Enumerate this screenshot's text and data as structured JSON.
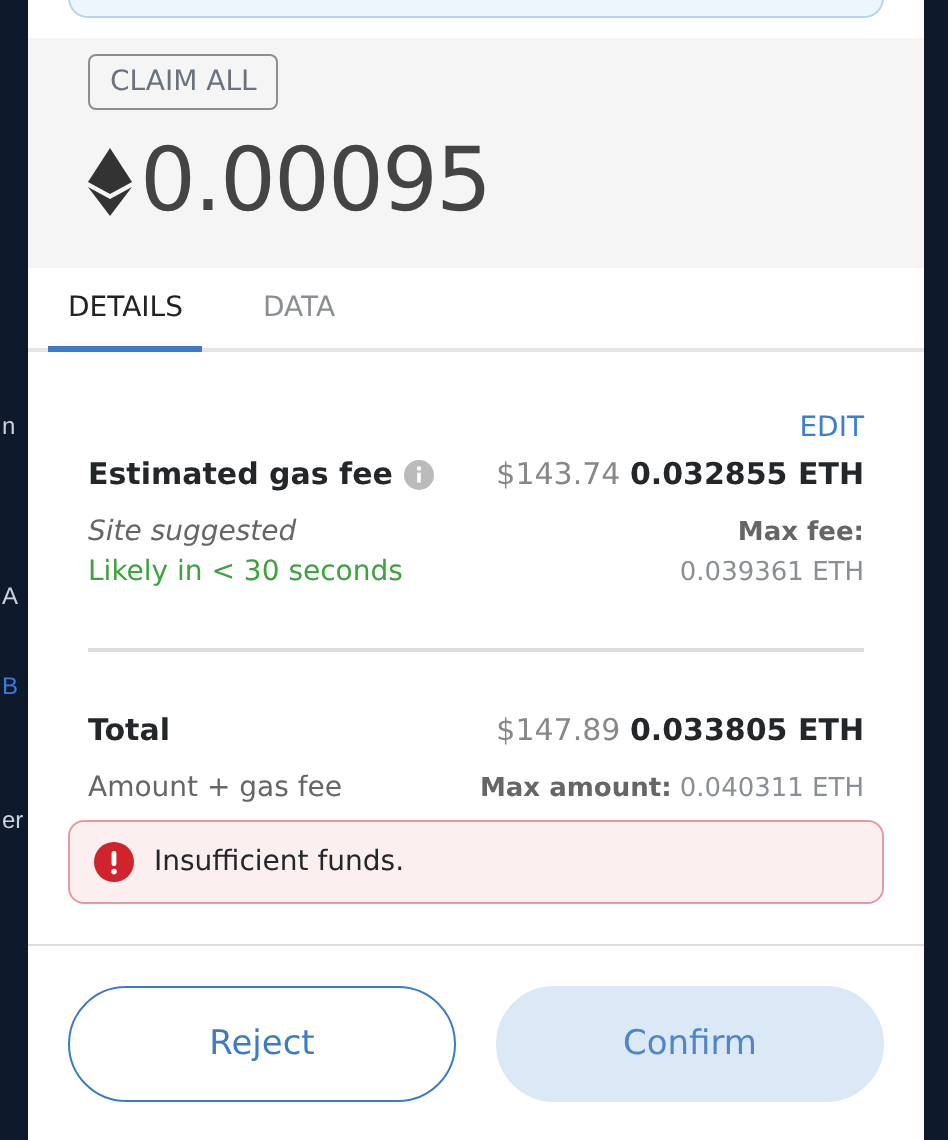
{
  "background_fragments": [
    "n",
    "A",
    "B",
    "er"
  ],
  "claim_button": {
    "label": "CLAIM ALL"
  },
  "amount": "0.00095",
  "tabs": [
    {
      "label": "DETAILS",
      "selected": true
    },
    {
      "label": "DATA",
      "selected": false
    }
  ],
  "edit_link": "EDIT",
  "gas_fee": {
    "label": "Estimated gas fee",
    "fiat": "$143.74",
    "eth": "0.032855 ETH",
    "source": "Site suggested",
    "timing": "Likely in < 30 seconds",
    "max_label": "Max fee:",
    "max_value": "0.039361 ETH"
  },
  "total": {
    "label": "Total",
    "fiat": "$147.89",
    "eth": "0.033805 ETH",
    "subtitle": "Amount + gas fee",
    "max_label": "Max amount:",
    "max_value": "0.040311 ETH"
  },
  "error": "Insufficient funds.",
  "buttons": [
    {
      "label": "Reject",
      "kind": "secondary",
      "disabled": false
    },
    {
      "label": "Confirm",
      "kind": "primary",
      "disabled": true
    }
  ]
}
